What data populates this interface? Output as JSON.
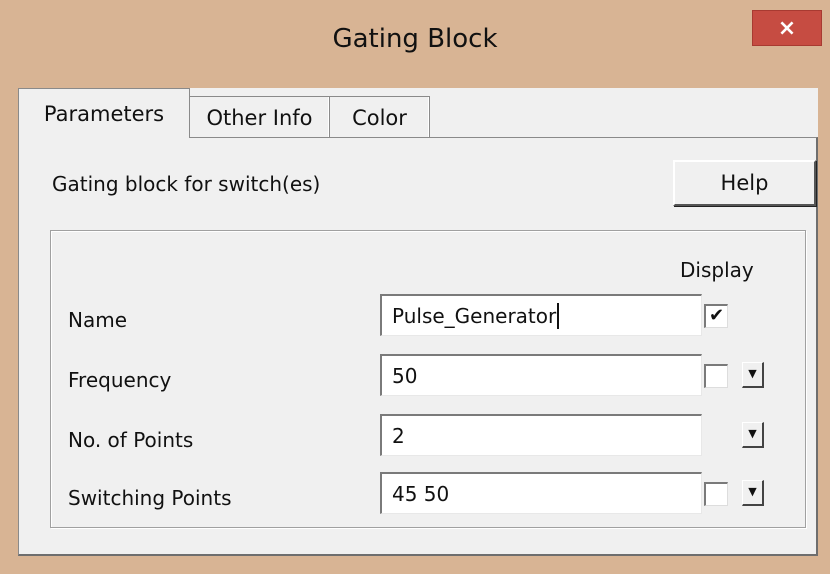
{
  "window": {
    "title": "Gating Block",
    "close_label": "×"
  },
  "tabs": [
    {
      "label": "Parameters",
      "active": true
    },
    {
      "label": "Other Info",
      "active": false
    },
    {
      "label": "Color",
      "active": false
    }
  ],
  "panel": {
    "description": "Gating block for switch(es)",
    "help_label": "Help",
    "display_header": "Display"
  },
  "params": [
    {
      "label": "Name",
      "value": "Pulse_Generator",
      "display_checked": true,
      "has_checkbox": true,
      "has_dropdown": false
    },
    {
      "label": "Frequency",
      "value": "50",
      "display_checked": false,
      "has_checkbox": true,
      "has_dropdown": true
    },
    {
      "label": "No. of Points",
      "value": "2",
      "display_checked": false,
      "has_checkbox": false,
      "has_dropdown": true
    },
    {
      "label": "Switching Points",
      "value": "45 50",
      "display_checked": false,
      "has_checkbox": true,
      "has_dropdown": true
    }
  ],
  "icons": {
    "check": "checkmark-icon",
    "dropdown": "dropdown-arrow-icon",
    "close": "close-icon"
  },
  "colors": {
    "title_bar": "#d8b494",
    "close_button": "#c64c42",
    "client": "#f0f0f0"
  }
}
